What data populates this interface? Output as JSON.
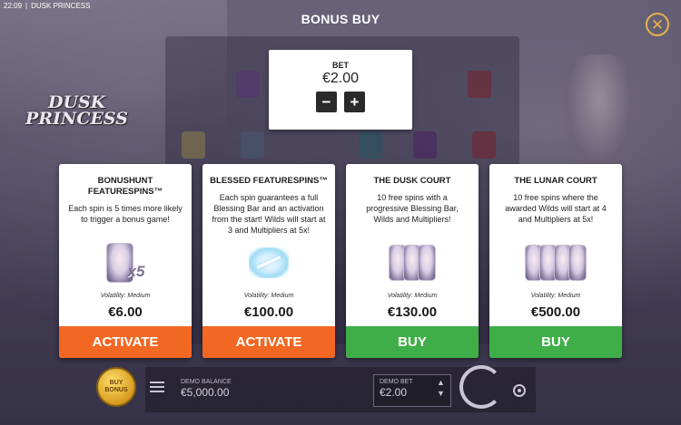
{
  "status_bar": {
    "time": "22:09",
    "separator": "|",
    "app_name": "DUSK PRINCESS"
  },
  "logo": {
    "line1": "DUSK",
    "line2": "PRINCESS"
  },
  "dialog": {
    "title": "BONUS BUY",
    "close_icon": "close-icon"
  },
  "bet": {
    "label": "BET",
    "value": "€2.00",
    "decrease": "−",
    "increase": "+"
  },
  "cards": [
    {
      "title": "BONUSHUNT FEATURESPINS™",
      "description": "Each spin is 5 times more likely to trigger a bonus game!",
      "art_icon": "princess-x5-icon",
      "art_text": "x5",
      "volatility": "Volatility: Medium",
      "price": "€6.00",
      "button": "ACTIVATE",
      "button_color": "#f26722"
    },
    {
      "title": "BLESSED FEATURESPINS™",
      "description": "Each spin guarantees a full Blessing Bar and an activation from the start! Wilds will start at 3 and Multipliers at 5x!",
      "art_icon": "magic-wand-icon",
      "volatility": "Volatility: Medium",
      "price": "€100.00",
      "button": "ACTIVATE",
      "button_color": "#f26722"
    },
    {
      "title": "THE DUSK COURT",
      "description": "10 free spins with a progressive Blessing Bar, Wilds and Multipliers!",
      "art_icon": "three-princesses-icon",
      "volatility": "Volatility: Medium",
      "price": "€130.00",
      "button": "BUY",
      "button_color": "#3fae49"
    },
    {
      "title": "THE LUNAR COURT",
      "description": "10 free spins where the awarded Wilds will start at 4 and Multipliers at 5x!",
      "art_icon": "four-princesses-icon",
      "volatility": "Volatility: Medium",
      "price": "€500.00",
      "button": "BUY",
      "button_color": "#3fae49"
    }
  ],
  "bottom_bar": {
    "buy_bonus": "BUY BONUS",
    "demo_balance_label": "DEMO BALANCE",
    "demo_balance_value": "€5,000.00",
    "demo_bet_label": "DEMO BET",
    "demo_bet_value": "€2.00"
  }
}
